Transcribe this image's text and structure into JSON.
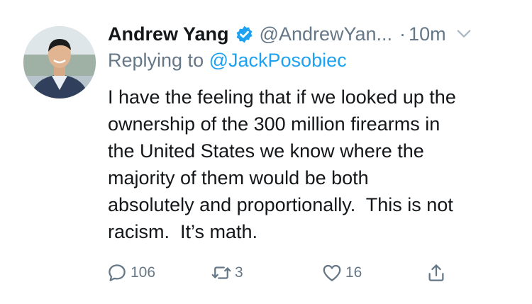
{
  "tweet": {
    "author": {
      "display_name": "Andrew Yang",
      "handle": "@AndrewYan...",
      "verified_icon": "verified-badge-icon",
      "avatar": "profile-photo"
    },
    "separator": "·",
    "time": "10m",
    "reply": {
      "prefix": "Replying to",
      "target": "@JackPosobiec"
    },
    "text_lines": [
      "I have the feeling that if we looked up the",
      "ownership of the 300 million firearms in",
      "the United States we know where the",
      "majority of them would be both",
      "absolutely and proportionally.  This is not",
      "racism.  It’s math."
    ],
    "actions": {
      "replies": "106",
      "retweets": "3",
      "likes": "16"
    }
  },
  "colors": {
    "text": "#14171a",
    "muted": "#657786",
    "accent": "#1da1f2"
  }
}
